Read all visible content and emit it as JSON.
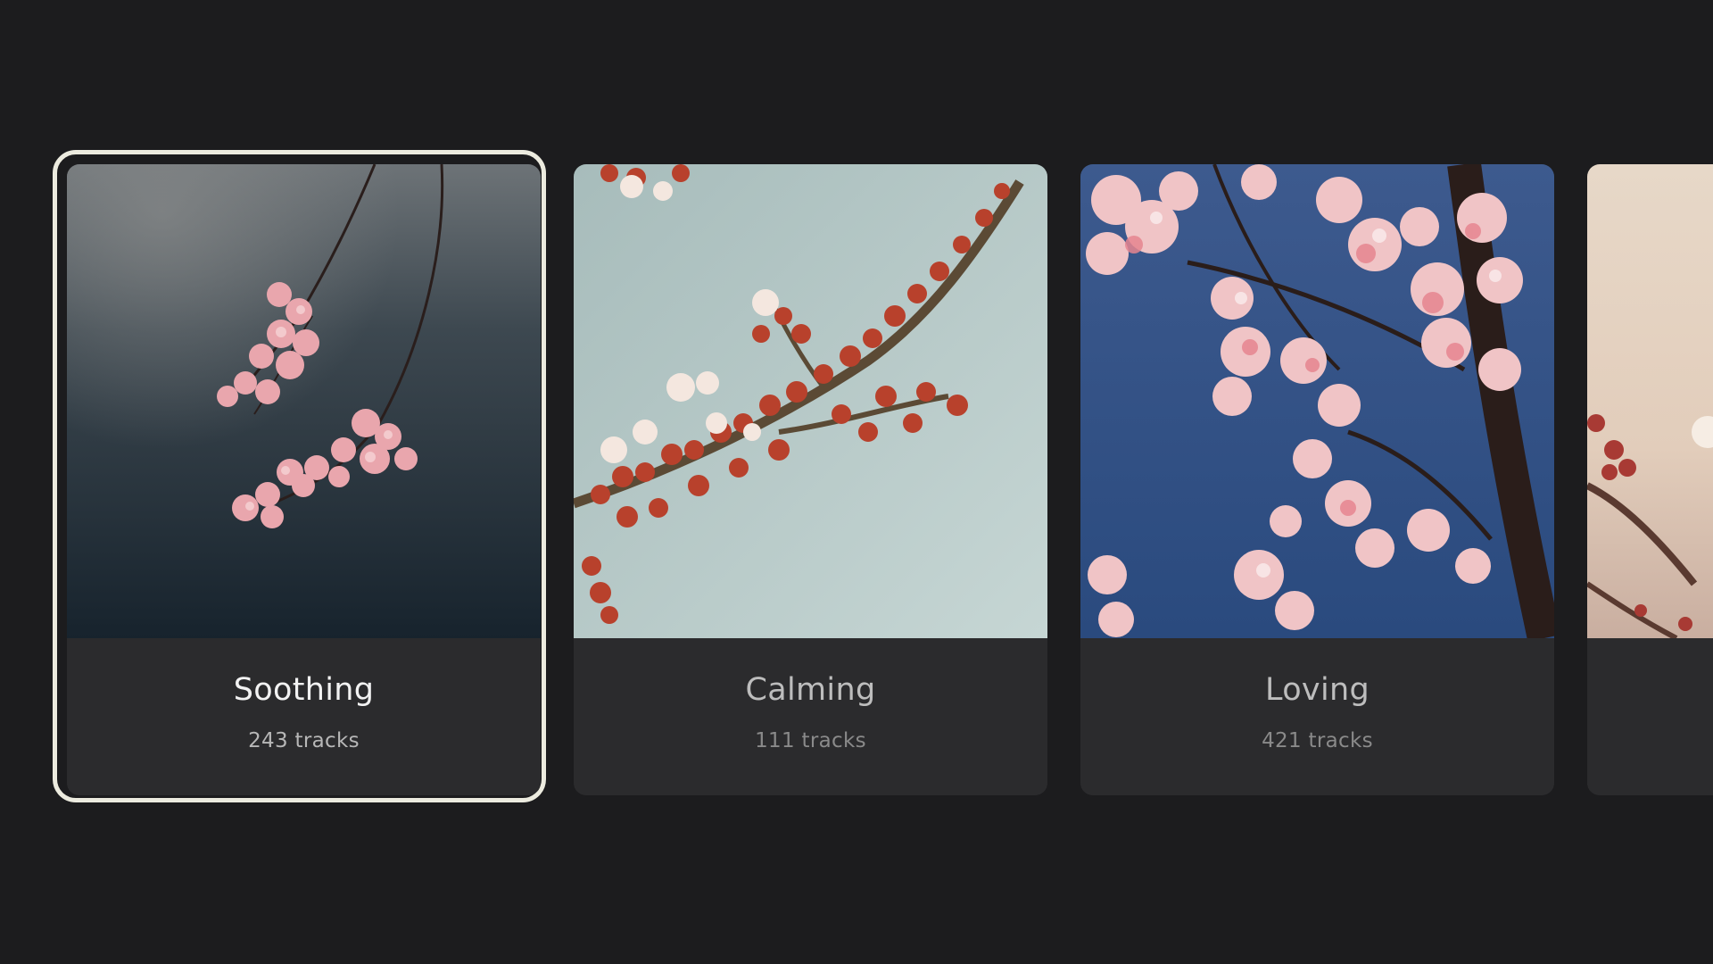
{
  "carousel": {
    "cards": [
      {
        "title": "Soothing",
        "count": "243 tracks"
      },
      {
        "title": "Calming",
        "count": "111 tracks"
      },
      {
        "title": "Loving",
        "count": "421 tracks"
      }
    ]
  },
  "colors": {
    "background": "#1c1c1e",
    "card": "#2b2b2d",
    "focus_ring": "#ecebdf"
  }
}
